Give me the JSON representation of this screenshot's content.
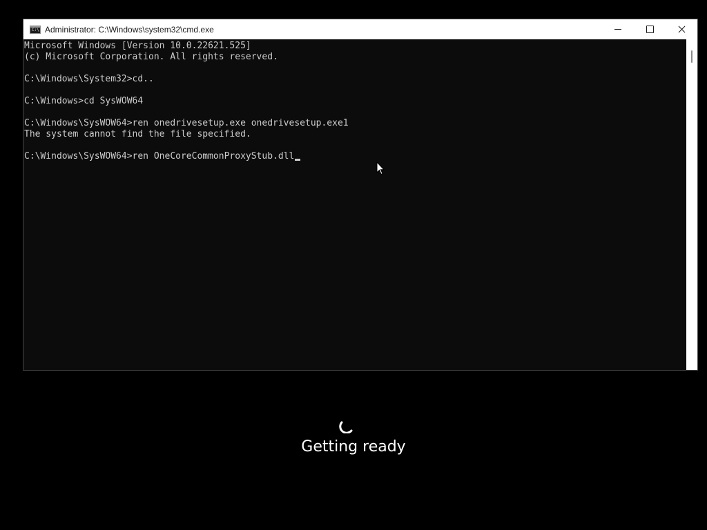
{
  "window": {
    "title": "Administrator: C:\\Windows\\system32\\cmd.exe",
    "icon": "command-prompt-icon",
    "icon_glyph": "C:\\"
  },
  "console": {
    "lines": [
      "Microsoft Windows [Version 10.0.22621.525]",
      "(c) Microsoft Corporation. All rights reserved.",
      "",
      "C:\\Windows\\System32>cd..",
      "",
      "C:\\Windows>cd SysWOW64",
      "",
      "C:\\Windows\\SysWOW64>ren onedrivesetup.exe onedrivesetup.exe1",
      "The system cannot find the file specified.",
      "",
      "C:\\Windows\\SysWOW64>ren OneCoreCommonProxyStub.dll"
    ],
    "text_color": "#cccccc",
    "background_color": "#0c0c0c"
  },
  "status": {
    "text": "Getting ready",
    "icon": "loading-spinner-icon"
  },
  "colors": {
    "page_background": "#000000",
    "titlebar_background": "#ffffff"
  }
}
